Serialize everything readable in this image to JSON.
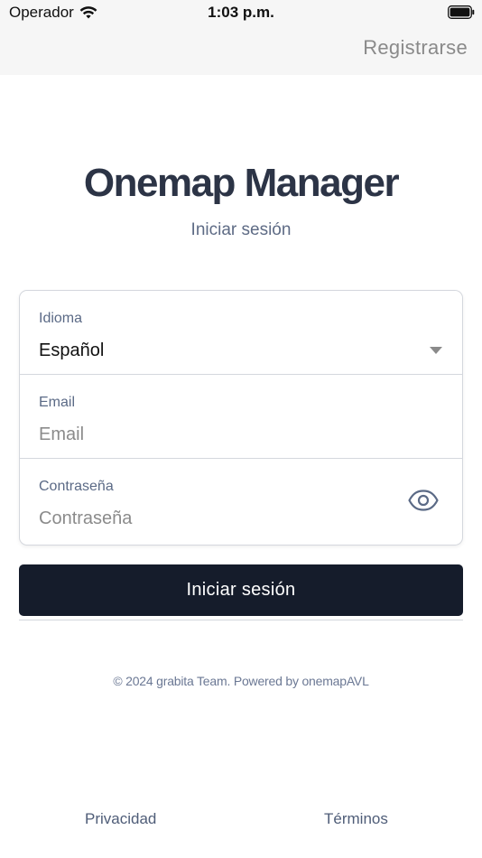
{
  "status_bar": {
    "carrier": "Operador",
    "time": "1:03 p.m.",
    "icons": [
      "wifi-icon",
      "battery-icon"
    ]
  },
  "nav": {
    "register_label": "Registrarse"
  },
  "header": {
    "title": "Onemap Manager",
    "subtitle": "Iniciar sesión"
  },
  "form": {
    "language": {
      "label": "Idioma",
      "value": "Español"
    },
    "email": {
      "label": "Email",
      "placeholder": "Email",
      "value": ""
    },
    "password": {
      "label": "Contraseña",
      "placeholder": "Contraseña",
      "value": "",
      "toggle_icon": "eye-icon"
    }
  },
  "actions": {
    "login_label": "Iniciar sesión"
  },
  "footer": {
    "copyright": "© 2024 grabita Team. Powered by onemapAVL",
    "privacy_label": "Privacidad",
    "terms_label": "Términos"
  },
  "colors": {
    "primary_button": "#151c2b",
    "title": "#2c3446",
    "muted_text": "#5e6b85",
    "border": "#d4d7dd"
  }
}
